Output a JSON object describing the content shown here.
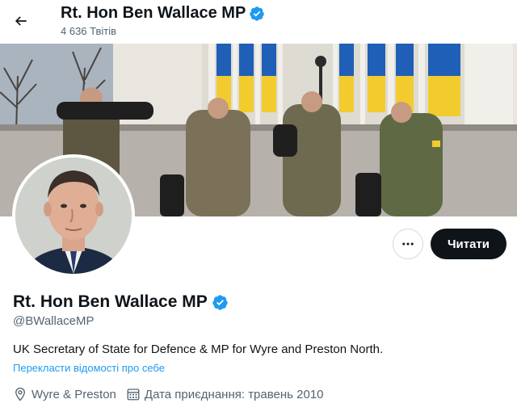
{
  "header": {
    "title": "Rt. Hon Ben Wallace MP",
    "tweet_count": "4 636 Твітів",
    "back_icon": "arrow-left-icon"
  },
  "profile": {
    "display_name": "Rt. Hon Ben Wallace MP",
    "handle": "@BWallaceMP",
    "bio": "UK Secretary of State for Defence & MP for Wyre and Preston North.",
    "translate_bio": "Перекласти відомості про себе",
    "location": "Wyre & Preston",
    "joined": "Дата приєднання: травень 2010",
    "verified_color": "#1d9bf0"
  },
  "actions": {
    "more_icon": "ellipsis-icon",
    "follow_label": "Читати"
  },
  "colors": {
    "accent": "#1d9bf0",
    "text": "#0f1419",
    "secondary_text": "#536471",
    "follow_bg": "#0f1419"
  }
}
